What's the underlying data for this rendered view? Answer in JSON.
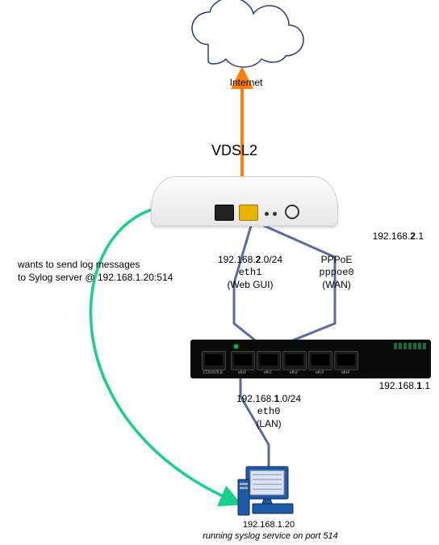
{
  "internet_label": "Internet",
  "link_type": "VDSL2",
  "modem_ip": "192.168.2.1",
  "note": {
    "line1": "wants to send log messages",
    "line2": "to Sylog server @ 192.168.1.20:514"
  },
  "eth1": {
    "subnet_prefix": "192.168.",
    "subnet_bold": "2",
    "subnet_suffix": ".0/24",
    "iface": "eth1",
    "role": "(Web GUI)"
  },
  "pppoe": {
    "proto": "PPPoE",
    "iface": "pppoe0",
    "role": "(WAN)"
  },
  "router_ip_prefix": "192.168.",
  "router_ip_bold": "1",
  "router_ip_suffix": ".1",
  "eth0": {
    "subnet_prefix": "192.168.",
    "subnet_bold": "1",
    "subnet_suffix": ".0/24",
    "iface": "eth0",
    "role": "(LAN)"
  },
  "workstation": {
    "ip": "192.168.1.20",
    "caption": "running syslog service on port 514"
  },
  "chart_data": null
}
